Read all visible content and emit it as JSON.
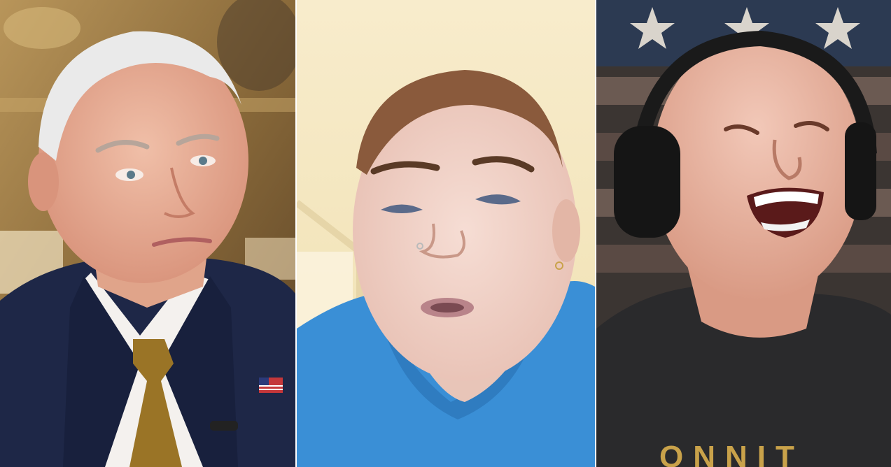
{
  "panels": [
    {
      "id": "left",
      "subject": "man-in-suit-photo"
    },
    {
      "id": "middle",
      "subject": "woman-in-blue-hoodie-photo"
    },
    {
      "id": "right",
      "subject": "man-laughing-with-headphones-photo"
    }
  ],
  "right_panel": {
    "shirt_text": "ONNIT"
  },
  "colors": {
    "left_background": "#8a6a3a",
    "suit": "#1e2747",
    "tie": "#9a7426",
    "middle_background": "#f3e6b8",
    "hoodie": "#3a8fd6",
    "right_background": "#3b3532",
    "flag_blue": "#2c3a52",
    "tshirt": "#2a2a2c",
    "shirt_print": "#c9a24a"
  }
}
